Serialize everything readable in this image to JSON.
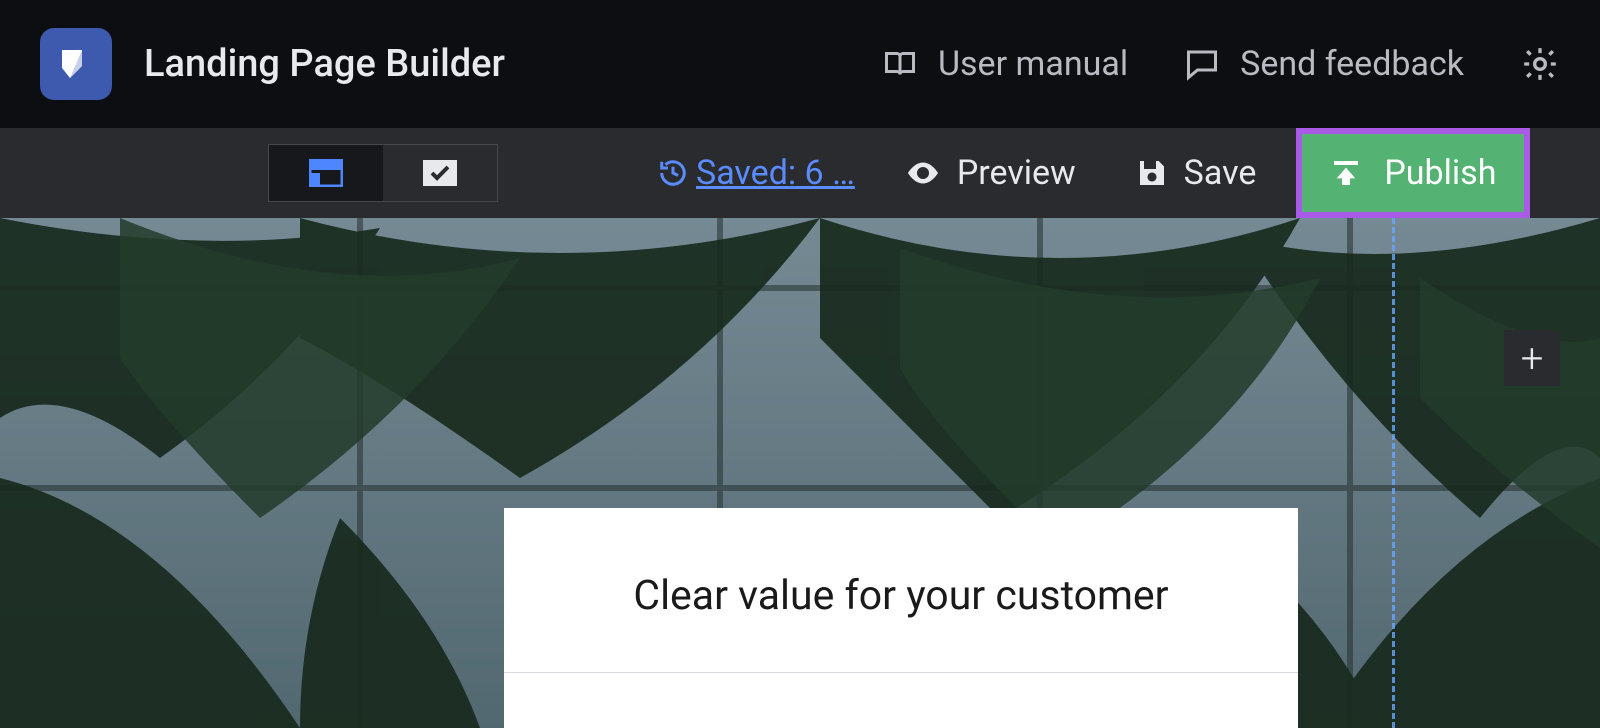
{
  "header": {
    "app_title": "Landing Page Builder",
    "user_manual_label": "User manual",
    "send_feedback_label": "Send feedback"
  },
  "toolbar": {
    "saved_label": " Saved: 6 …",
    "preview_label": "Preview",
    "save_label": "Save",
    "publish_label": "Publish"
  },
  "canvas": {
    "headline": "Clear value for your customer",
    "add_symbol": "+"
  },
  "colors": {
    "accent_blue": "#5a8cff",
    "publish_green": "#54b373",
    "highlight_border": "#a95be8",
    "logo_bg": "#3d5aae"
  }
}
